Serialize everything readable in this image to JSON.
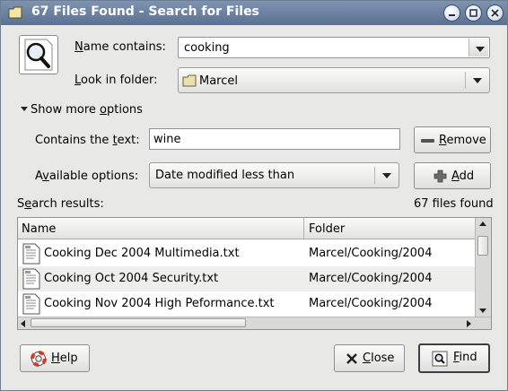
{
  "window": {
    "title": "67 Files Found - Search for Files"
  },
  "form": {
    "name_label_u": "N",
    "name_label_rest": "ame contains:",
    "name_value": "cooking",
    "look_label_u": "L",
    "look_label_rest": "ook in folder:",
    "look_value": "Marcel",
    "more_options_pre": "Show more ",
    "more_options_u": "o",
    "more_options_post": "ptions"
  },
  "options": {
    "contains_pre": "Contains the ",
    "contains_u": "t",
    "contains_post": "ext:",
    "contains_value": "wine",
    "remove_u": "R",
    "remove_rest": "emove",
    "available_pre": "A",
    "available_u": "v",
    "available_post": "ailable options:",
    "available_value": "Date modified less than",
    "add_u": "A",
    "add_rest": "dd"
  },
  "results": {
    "label_pre": "S",
    "label_u": "e",
    "label_post": "arch results:",
    "count": "67 files found",
    "columns": [
      "Name",
      "Folder"
    ],
    "rows": [
      {
        "name": "Cooking Dec 2004 Multimedia.txt",
        "folder": "Marcel/Cooking/2004"
      },
      {
        "name": "Cooking Oct 2004 Security.txt",
        "folder": "Marcel/Cooking/2004"
      },
      {
        "name": "Cooking Nov 2004 High Peformance.txt",
        "folder": "Marcel/Cooking/2004"
      }
    ]
  },
  "buttons": {
    "help_u": "H",
    "help_rest": "elp",
    "close_u": "C",
    "close_rest": "lose",
    "find_u": "F",
    "find_rest": "ind"
  },
  "icons": {
    "app": "magnifier-icon",
    "folder": "folder-icon",
    "file": "text-file-icon",
    "help": "lifebuoy-icon",
    "close": "x-icon",
    "find": "find-icon",
    "remove": "minus-icon",
    "add": "plus-icon"
  }
}
